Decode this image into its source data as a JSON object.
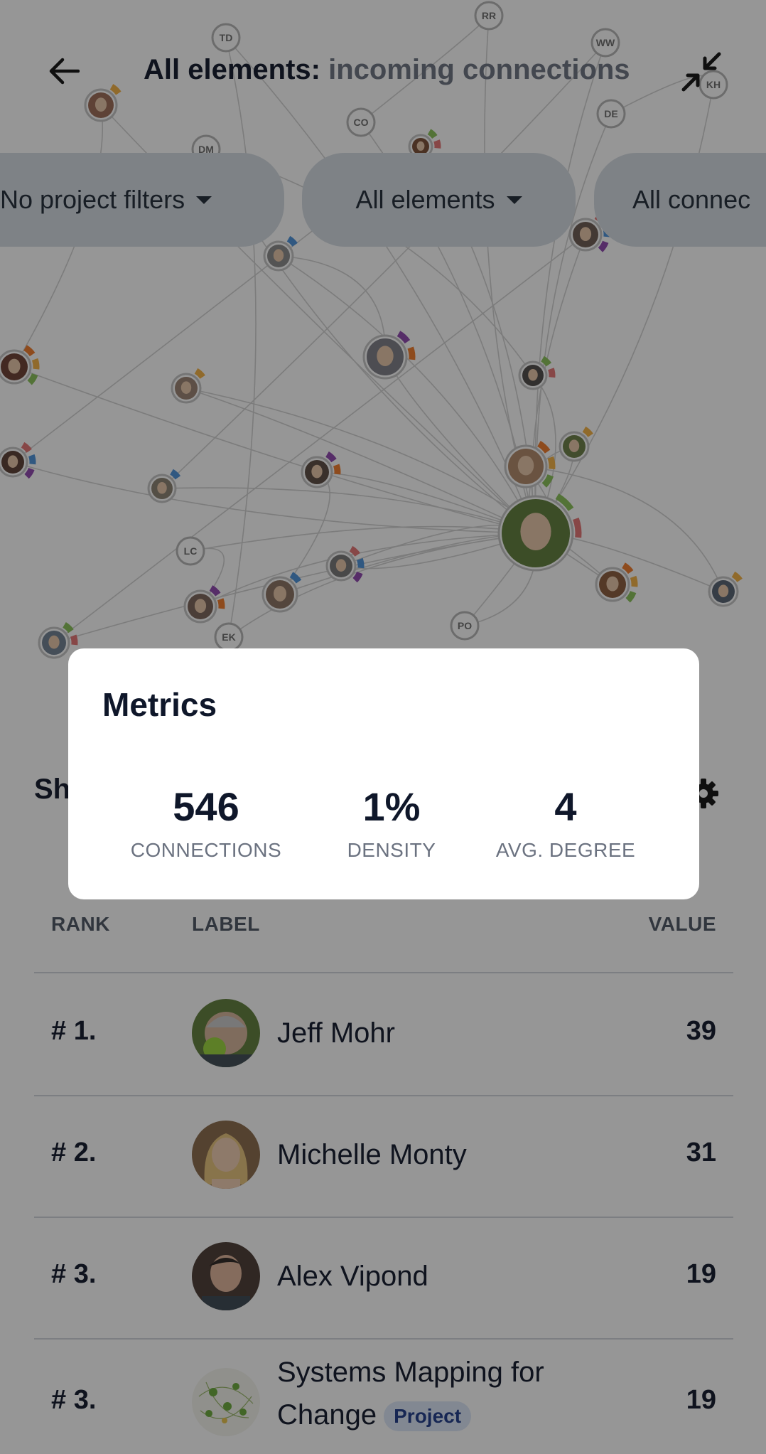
{
  "header": {
    "title_main": "All elements:",
    "title_sub": " incoming connections"
  },
  "filters": [
    {
      "label": "No project filters"
    },
    {
      "label": "All elements"
    },
    {
      "label": "All connec"
    }
  ],
  "graph": {
    "initial_nodes": [
      "RR",
      "TD",
      "WW",
      "KH",
      "DE",
      "CO",
      "DM",
      "LC",
      "EK",
      "PO"
    ],
    "ring_colors": [
      "#f5b041",
      "#88c057",
      "#e57373",
      "#4a90d9",
      "#8e44ad",
      "#f07a28"
    ]
  },
  "panel": {
    "heading": "Sh",
    "columns": {
      "rank": "RANK",
      "label": "LABEL",
      "value": "VALUE"
    },
    "rows": [
      {
        "rank": "# 1.",
        "name": "Jeff Mohr",
        "value": "39"
      },
      {
        "rank": "# 2.",
        "name": "Michelle Monty",
        "value": "31"
      },
      {
        "rank": "# 3.",
        "name": "Alex Vipond",
        "value": "19"
      },
      {
        "rank": "# 3.",
        "name_line1": "Systems Mapping for",
        "name_line2": "Change",
        "badge": "Project",
        "value": "19"
      }
    ]
  },
  "metrics": {
    "title": "Metrics",
    "items": [
      {
        "value": "546",
        "label": "CONNECTIONS"
      },
      {
        "value": "1%",
        "label": "DENSITY"
      },
      {
        "value": "4",
        "label": "AVG. DEGREE"
      }
    ]
  }
}
